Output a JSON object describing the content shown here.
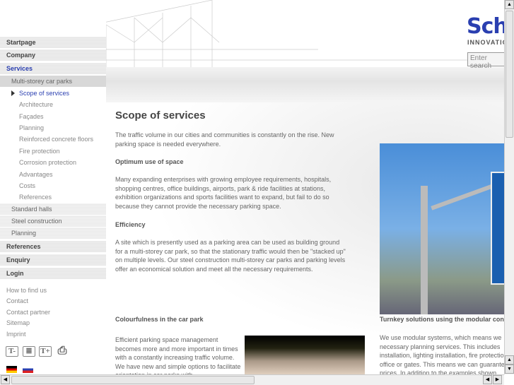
{
  "sidebar": {
    "main_items": [
      {
        "label": "Startpage"
      },
      {
        "label": "Company"
      },
      {
        "label": "Services"
      }
    ],
    "sub_items": [
      {
        "label": "Multi-storey car parks"
      }
    ],
    "sub_sub_items": [
      {
        "label": "Scope of services"
      },
      {
        "label": "Architecture"
      },
      {
        "label": "Façades"
      },
      {
        "label": "Planning"
      },
      {
        "label": "Reinforced concrete floors"
      },
      {
        "label": "Fire protection"
      },
      {
        "label": "Corrosion protection"
      },
      {
        "label": "Advantages"
      },
      {
        "label": "Costs"
      },
      {
        "label": "References"
      }
    ],
    "sub_items2": [
      {
        "label": "Standard halls"
      },
      {
        "label": "Steel construction"
      },
      {
        "label": "Planning"
      }
    ],
    "main_items2": [
      {
        "label": "References"
      },
      {
        "label": "Enquiry"
      },
      {
        "label": "Login"
      }
    ],
    "footer_links": [
      {
        "label": "How to find us"
      },
      {
        "label": "Contact"
      },
      {
        "label": "Contact partner"
      },
      {
        "label": "Sitemap"
      },
      {
        "label": "Imprint"
      }
    ],
    "tools": {
      "decrease": "T-",
      "text": "≣",
      "increase": "T+",
      "print": "⎙"
    }
  },
  "header": {
    "logo": "Schäfer",
    "tagline": "INNOVATIONS",
    "search_placeholder": "Enter search"
  },
  "main": {
    "title": "Scope of services",
    "intro": "The traffic volume in our cities and communities is constantly on the rise. New parking space is needed everywhere.",
    "h1": "Optimum use of space",
    "p1": "Many expanding enterprises with growing employee requirements, hospitals, shopping centres, office buildings, airports, park & ride facilities at stations, exhibition organizations and sports facilities want to expand, but fail to do so because they cannot provide the necessary parking space.",
    "h2": "Efficiency",
    "p2": "A site which is presently used as a parking area can be used as building ground for a multi-storey car park, so that the stationary traffic would then be \"stacked up\" on multiple levels. Our steel construction multi-storey car parks and parking levels offer an economical solution and meet all the necessary requirements.",
    "h3": "Colourfulness in the car park",
    "p3": "Efficient parking space management becomes more and more important in times with a constantly increasing traffic volume. We have new and simple options to facilitate orientation in car parks with",
    "caption": "Turnkey solutions using the modular concept",
    "right_lines": [
      "We use modular systems, which means we",
      "necessary planning services. This includes",
      "installation, lighting installation, fire protection",
      "office or gates. This means we can guarantee",
      "prices. In addition to the examples shown"
    ]
  }
}
